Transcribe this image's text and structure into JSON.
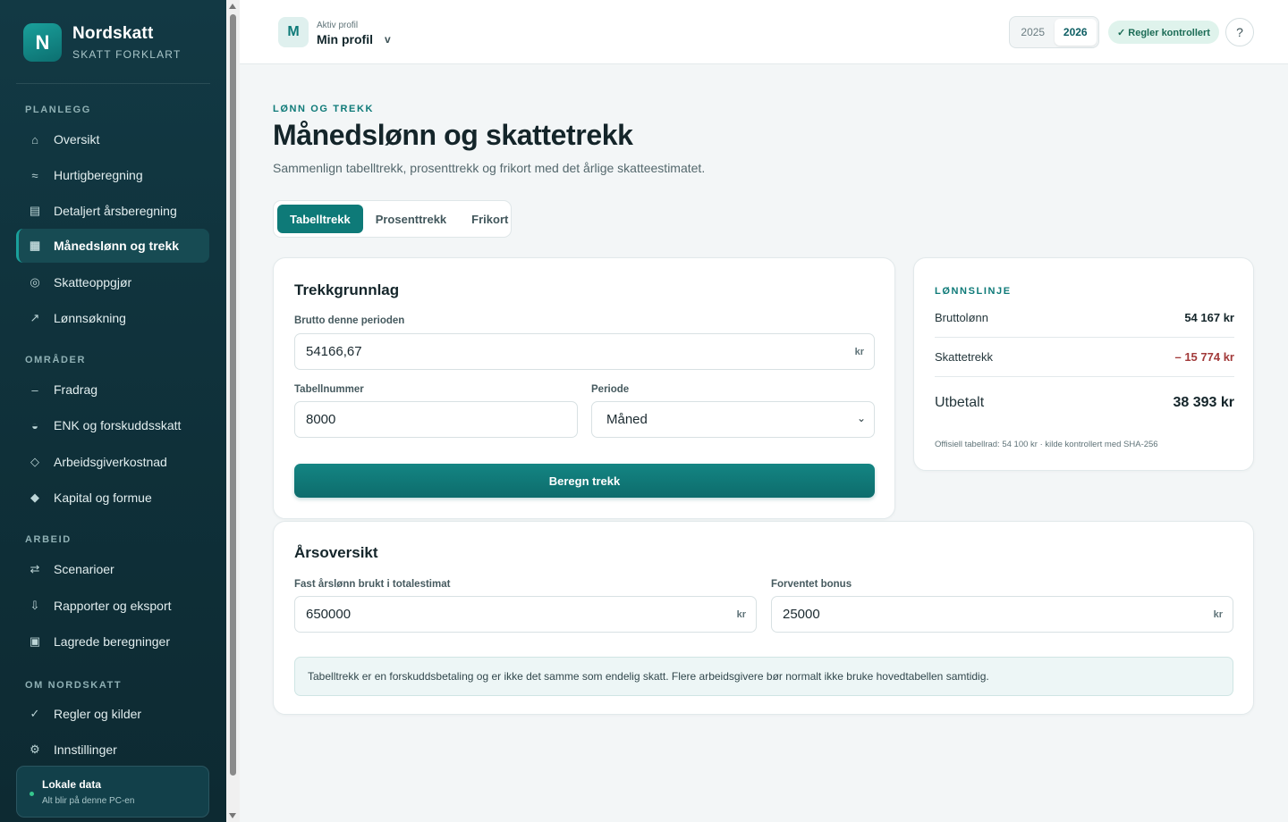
{
  "brand": {
    "logo_letter": "N",
    "name": "Nordskatt",
    "tagline": "SKATT FORKLART"
  },
  "sidebar": {
    "sections": {
      "planlegg": "PLANLEGG",
      "omrader": "OMRÅDER",
      "arbeid": "ARBEID",
      "om": "OM NORDSKATT"
    },
    "items": [
      {
        "label": "Oversikt",
        "icon": "home-icon"
      },
      {
        "label": "Hurtigberegning",
        "icon": "wave-icon"
      },
      {
        "label": "Detaljert årsberegning",
        "icon": "list-icon"
      },
      {
        "label": "Månedslønn og trekk",
        "icon": "grid-icon",
        "active": true
      },
      {
        "label": "Skatteoppgjør",
        "icon": "target-icon"
      },
      {
        "label": "Lønnsøkning",
        "icon": "trend-arrow-icon"
      },
      {
        "label": "Fradrag",
        "icon": "minus-icon"
      },
      {
        "label": "ENK og forskuddsskatt",
        "icon": "half-circle-icon"
      },
      {
        "label": "Arbeidsgiverkostnad",
        "icon": "diamond-outline-icon"
      },
      {
        "label": "Kapital og formue",
        "icon": "diamond-filled-icon"
      },
      {
        "label": "Scenarioer",
        "icon": "swap-icon"
      },
      {
        "label": "Rapporter og eksport",
        "icon": "download-icon"
      },
      {
        "label": "Lagrede beregninger",
        "icon": "saved-box-icon"
      },
      {
        "label": "Regler og kilder",
        "icon": "check-icon"
      },
      {
        "label": "Innstillinger",
        "icon": "gear-icon"
      }
    ],
    "local": {
      "title": "Lokale data",
      "subtitle": "Alt blir på denne PC-en"
    }
  },
  "topbar": {
    "avatar_letter": "M",
    "profile_caption": "Aktiv profil",
    "profile_name": "Min profil",
    "profile_chevron": "v",
    "years": [
      "2025",
      "2026"
    ],
    "active_year": "2026",
    "rules_badge": "✓ Regler kontrollert",
    "help": "?"
  },
  "page": {
    "eyebrow": "LØNN OG TREKK",
    "title": "Månedslønn og skattetrekk",
    "subtitle": "Sammenlign tabelltrekk, prosenttrekk og frikort med det årlige skatteestimatet.",
    "tabs": [
      "Tabelltrekk",
      "Prosenttrekk",
      "Frikort"
    ],
    "active_tab": "Tabelltrekk"
  },
  "trekk": {
    "title": "Trekkgrunnlag",
    "gross_label": "Brutto denne perioden",
    "gross_value": "54166,67",
    "gross_suffix": "kr",
    "table_label": "Tabellnummer",
    "table_value": "8000",
    "period_label": "Periode",
    "period_value": "Måned",
    "button": "Beregn trekk"
  },
  "summary": {
    "eyebrow": "LØNNSLINJE",
    "gross_label": "Bruttolønn",
    "gross_value": "54 167 kr",
    "tax_label": "Skattetrekk",
    "tax_value": "– 15 774 kr",
    "net_label": "Utbetalt",
    "net_value": "38 393 kr",
    "footnote": "Offisiell tabellrad: 54 100 kr · kilde kontrollert med SHA-256"
  },
  "annual": {
    "title": "Årsoversikt",
    "salary_label": "Fast årslønn brukt i totalestimat",
    "salary_value": "650000",
    "salary_suffix": "kr",
    "bonus_label": "Forventet bonus",
    "bonus_value": "25000",
    "bonus_suffix": "kr",
    "notice": "Tabelltrekk er en forskuddsbetaling og er ikke det samme som endelig skatt. Flere arbeidsgivere bør normalt ikke bruke hovedtabellen samtidig."
  }
}
